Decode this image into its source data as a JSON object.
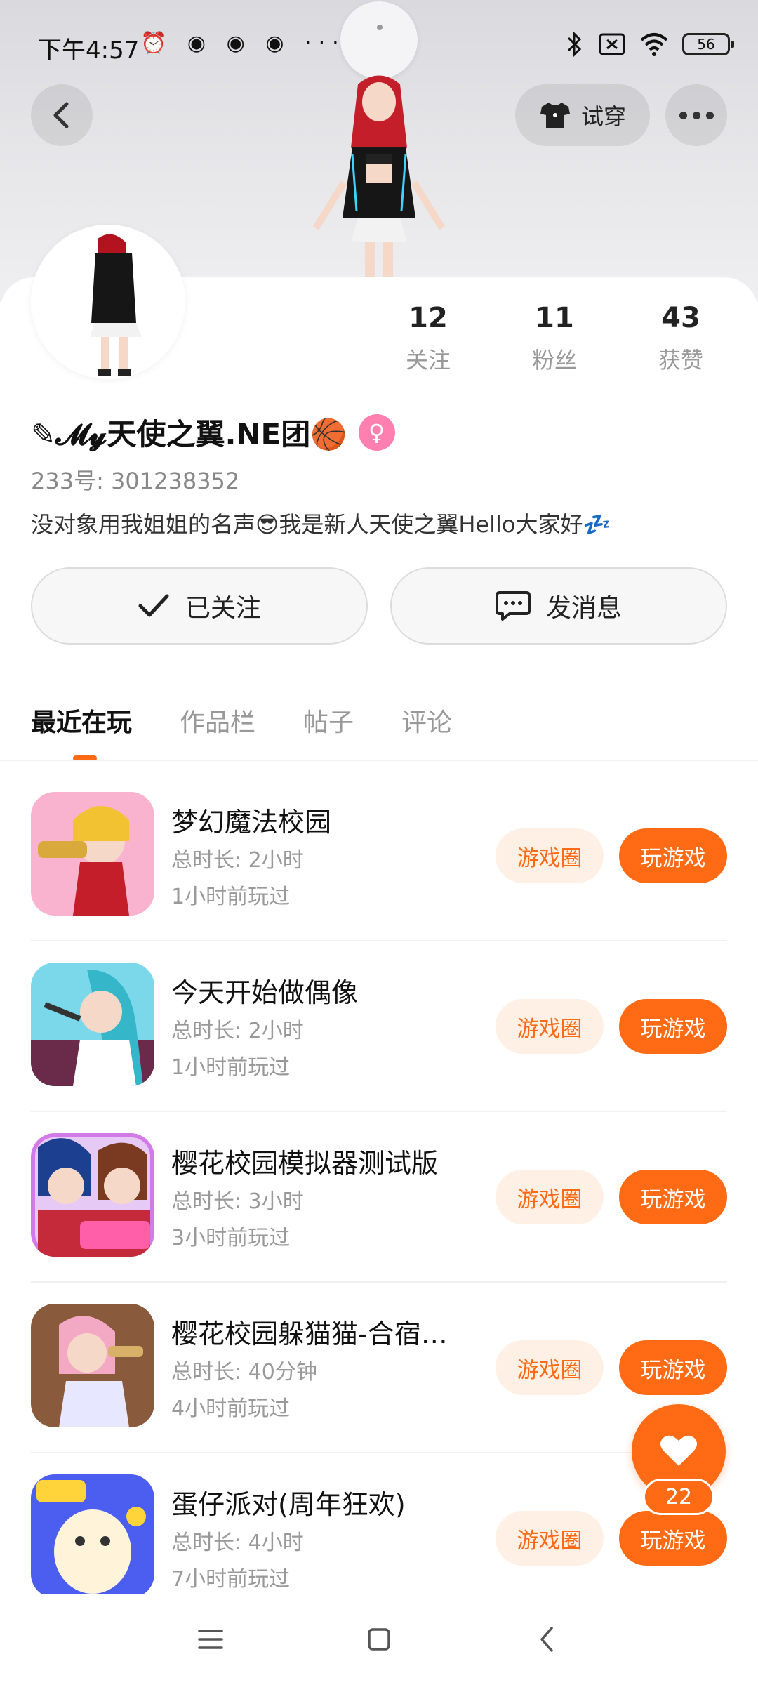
{
  "status_bar": {
    "time": "下午4:57",
    "left_icons": "⏰ ◉ ◉ ◉ ···",
    "battery": "56"
  },
  "header": {
    "tryon_label": "试穿"
  },
  "profile": {
    "stats": [
      {
        "value": "12",
        "label": "关注"
      },
      {
        "value": "11",
        "label": "粉丝"
      },
      {
        "value": "43",
        "label": "获赞"
      }
    ],
    "username": "✎𝓜𝔂天使之翼.NE团🏀",
    "gender_symbol": "♀",
    "uid": "233号: 301238352",
    "bio": "没对象用我姐姐的名声😎我是新人天使之翼Hello大家好💤"
  },
  "actions": {
    "follow_label": "已关注",
    "message_label": "发消息"
  },
  "tabs": [
    "最近在玩",
    "作品栏",
    "帖子",
    "评论"
  ],
  "games": [
    {
      "title": "梦幻魔法校园",
      "duration": "总时长: 2小时",
      "last_played": "1小时前玩过",
      "circle_label": "游戏圈",
      "play_label": "玩游戏",
      "icon_color": "#f7a1c4"
    },
    {
      "title": "今天开始做偶像",
      "duration": "总时长: 2小时",
      "last_played": "1小时前玩过",
      "circle_label": "游戏圈",
      "play_label": "玩游戏",
      "icon_color": "#6fd2e8"
    },
    {
      "title": "樱花校园模拟器测试版",
      "duration": "总时长: 3小时",
      "last_played": "3小时前玩过",
      "circle_label": "游戏圈",
      "play_label": "玩游戏",
      "icon_color": "#d8b3f0"
    },
    {
      "title": "樱花校园躲猫猫-合宿…",
      "duration": "总时长: 40分钟",
      "last_played": "4小时前玩过",
      "circle_label": "游戏圈",
      "play_label": "玩游戏",
      "icon_color": "#8a5a3c"
    },
    {
      "title": "蛋仔派对(周年狂欢)",
      "duration": "总时长: 4小时",
      "last_played": "7小时前玩过",
      "circle_label": "游戏圈",
      "play_label": "玩游戏",
      "icon_color": "#5b6cf0"
    }
  ],
  "like": {
    "count": "22"
  },
  "colors": {
    "accent": "#ff6a14",
    "accent_soft": "#fff0e5"
  }
}
